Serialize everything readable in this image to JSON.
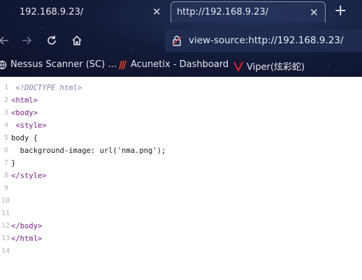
{
  "tabs": [
    {
      "title": "192.168.9.23/",
      "active": false
    },
    {
      "title": "http://192.168.9.23/",
      "active": true
    }
  ],
  "nav": {
    "url": "view-source:http://192.168.9.23/",
    "icons": [
      "back-arrow-icon",
      "forward-arrow-icon",
      "reload-icon",
      "home-icon",
      "lock-icon"
    ]
  },
  "bookmarks": [
    {
      "label": "Nessus Scanner (SC) ...",
      "icon": "globe-icon"
    },
    {
      "label": "Acunetix - Dashboard",
      "icon": "acunetix-icon"
    },
    {
      "label": "Viper(炫彩蛇)",
      "icon": "viper-icon"
    }
  ],
  "source_lines": [
    {
      "num": "1",
      "indent": " ",
      "text": "<!DOCTYPE html>",
      "kind": "doctype"
    },
    {
      "num": "2",
      "indent": "",
      "text": "<html>",
      "kind": "tag"
    },
    {
      "num": "3",
      "indent": "",
      "text": "<body>",
      "kind": "tag"
    },
    {
      "num": "4",
      "indent": " ",
      "text": "<style>",
      "kind": "tag"
    },
    {
      "num": "5",
      "indent": "",
      "text": "body {",
      "kind": "text"
    },
    {
      "num": "6",
      "indent": "  ",
      "text": "background-image: url('nma.png');",
      "kind": "text"
    },
    {
      "num": "7",
      "indent": "",
      "text": "}",
      "kind": "text"
    },
    {
      "num": "8",
      "indent": "",
      "text": "</style>",
      "kind": "tag"
    },
    {
      "num": "9",
      "indent": "",
      "text": "",
      "kind": "text"
    },
    {
      "num": "10",
      "indent": "",
      "text": "",
      "kind": "text"
    },
    {
      "num": "11",
      "indent": "",
      "text": "",
      "kind": "text"
    },
    {
      "num": "12",
      "indent": "",
      "text": "</body>",
      "kind": "tag"
    },
    {
      "num": "13",
      "indent": "",
      "text": "</html>",
      "kind": "tag"
    },
    {
      "num": "14",
      "indent": "",
      "text": "",
      "kind": "text"
    }
  ]
}
